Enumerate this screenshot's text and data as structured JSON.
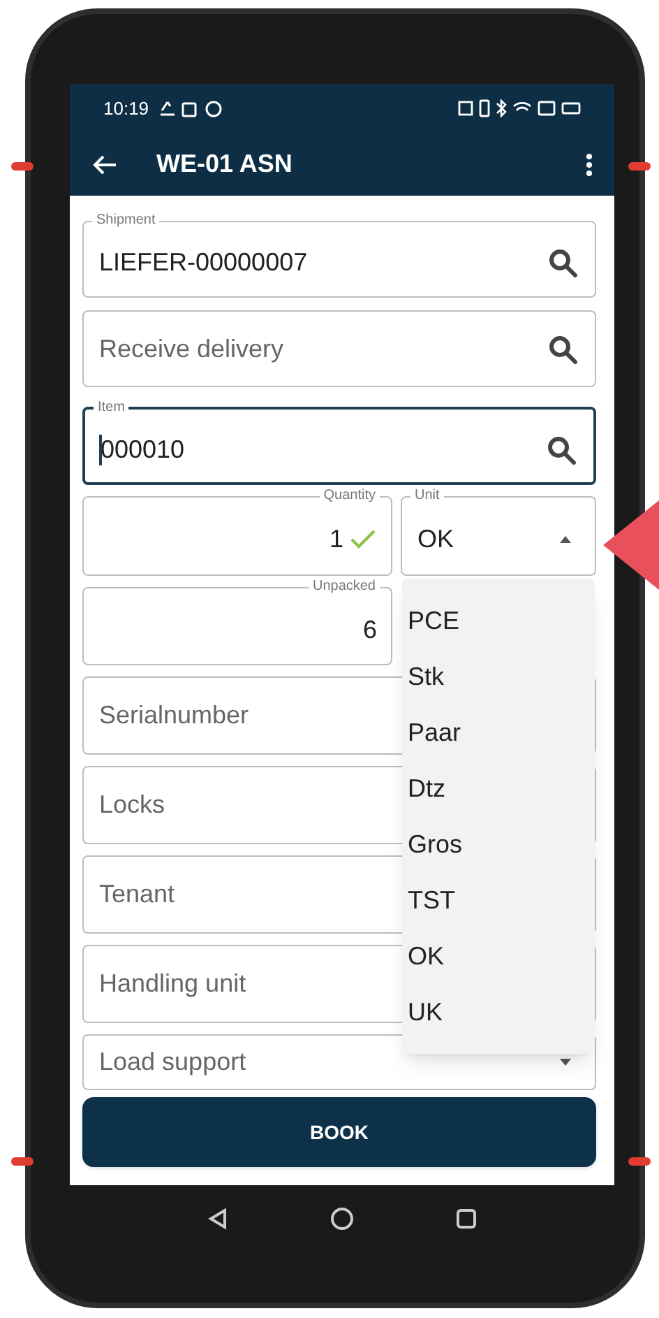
{
  "status_bar": {
    "time": "10:19"
  },
  "app_bar": {
    "title": "WE-01 ASN"
  },
  "rows": [
    [
      {
        "kind": "search",
        "label": "Shipment",
        "value": "LIEFER-00000007",
        "focused": false
      }
    ],
    [
      {
        "kind": "search",
        "placeholder": "Receive delivery",
        "focused": false
      }
    ],
    [
      {
        "kind": "search",
        "label": "Item",
        "value": "000010",
        "focused": true
      }
    ],
    [
      {
        "kind": "number",
        "label": "Quantity",
        "value": "1",
        "valid": true,
        "focused": false
      },
      {
        "kind": "select",
        "label": "Unit",
        "value": "OK",
        "expanded": true,
        "focused": false,
        "options": [
          "PCE",
          "Stk",
          "Paar",
          "Dtz",
          "Gros",
          "TST",
          "OK",
          "UK"
        ]
      }
    ],
    [
      {
        "kind": "number",
        "label": "Unpacked",
        "value": "6",
        "valid": false,
        "focused": false
      }
    ],
    [
      {
        "kind": "text",
        "placeholder": "Serialnumber",
        "focused": false
      }
    ],
    [
      {
        "kind": "text",
        "placeholder": "Locks",
        "focused": false
      }
    ],
    [
      {
        "kind": "text",
        "placeholder": "Tenant",
        "focused": false
      }
    ],
    [
      {
        "kind": "text",
        "placeholder": "Handling unit",
        "focused": false
      }
    ],
    [
      {
        "kind": "select",
        "placeholder": "Load support",
        "expanded": false,
        "focused": false
      }
    ]
  ],
  "book_button": {
    "label": "BOOK"
  }
}
